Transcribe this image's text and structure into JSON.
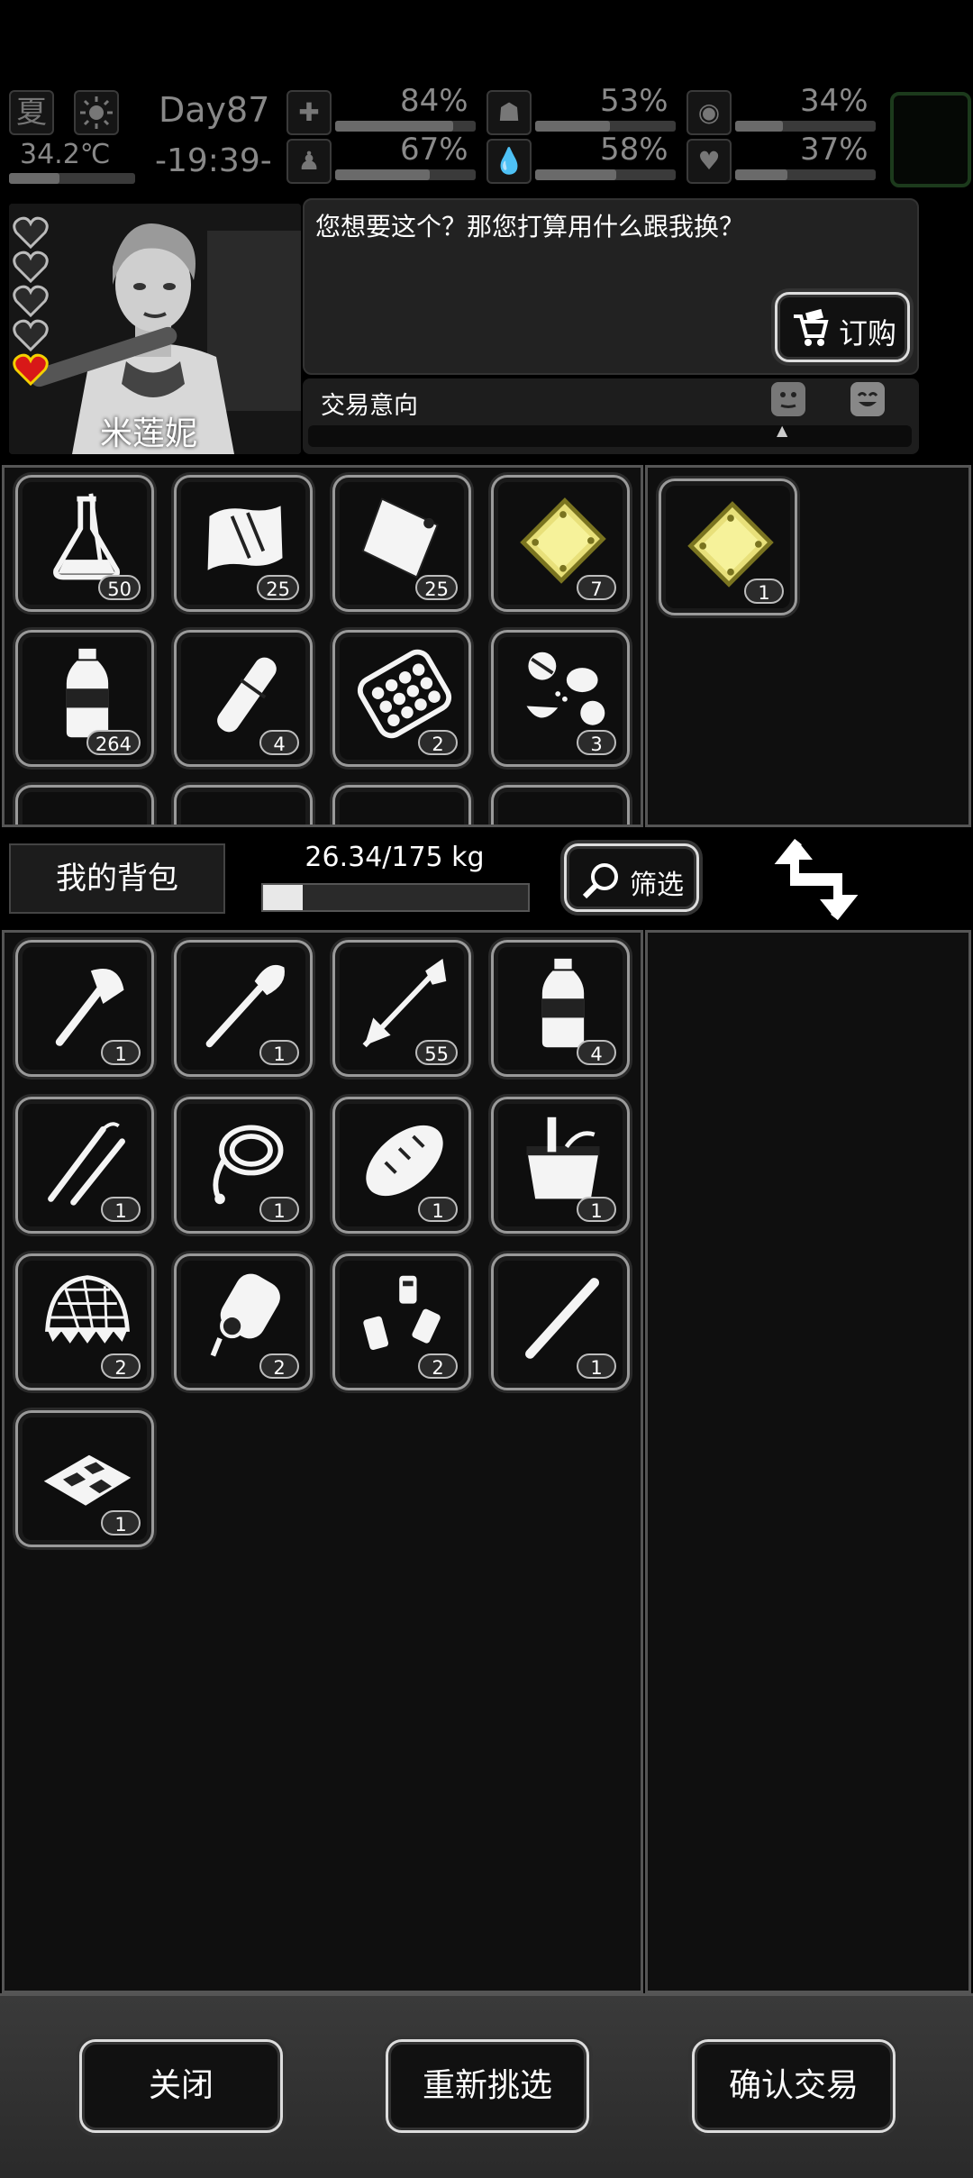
{
  "hud": {
    "season": "夏",
    "temperature": "34.2℃",
    "day": "Day87",
    "time": "-19:39-",
    "stats": [
      {
        "icon": "medkit-icon",
        "value": "84%",
        "level": 0.84
      },
      {
        "icon": "stomach-icon",
        "value": "53%",
        "level": 0.53
      },
      {
        "icon": "mental-icon",
        "value": "34%",
        "level": 0.34
      },
      {
        "icon": "stamina-icon",
        "value": "67%",
        "level": 0.67
      },
      {
        "icon": "water-drop-icon",
        "value": "58%",
        "level": 0.58
      },
      {
        "icon": "heart-icon",
        "value": "37%",
        "level": 0.37
      }
    ]
  },
  "npc": {
    "name": "米莲妮",
    "dialog": "您想要这个？那您打算用什么跟我换？",
    "order_label": "订购",
    "trade_intent_label": "交易意向",
    "hearts_total": 5,
    "hearts_filled": 1
  },
  "trader_items": [
    {
      "icon": "flask-icon",
      "count": "50"
    },
    {
      "icon": "cloth-icon",
      "count": "25"
    },
    {
      "icon": "bag-icon",
      "count": "25"
    },
    {
      "icon": "gold-plate-icon",
      "count": "7",
      "highlight": true
    },
    {
      "icon": "water-bottle-icon",
      "count": "264"
    },
    {
      "icon": "bandage-roll-icon",
      "count": "4"
    },
    {
      "icon": "pill-blister-icon",
      "count": "2"
    },
    {
      "icon": "pills-icon",
      "count": "3"
    }
  ],
  "selected_items": [
    {
      "icon": "gold-plate-icon",
      "count": "1",
      "highlight": true
    }
  ],
  "backpack": {
    "title": "我的背包",
    "weight_text": "26.34/175 kg",
    "weight_fraction": 0.15,
    "filter_label": "筛选"
  },
  "backpack_items": [
    {
      "icon": "axe-icon",
      "count": "1"
    },
    {
      "icon": "shovel-icon",
      "count": "1"
    },
    {
      "icon": "arrow-icon",
      "count": "55"
    },
    {
      "icon": "water-bottle-icon",
      "count": "4"
    },
    {
      "icon": "tweezers-icon",
      "count": "1"
    },
    {
      "icon": "rope-icon",
      "count": "1"
    },
    {
      "icon": "bread-icon",
      "count": "1"
    },
    {
      "icon": "bucket-icon",
      "count": "1"
    },
    {
      "icon": "net-icon",
      "count": "2"
    },
    {
      "icon": "glue-bottle-icon",
      "count": "2"
    },
    {
      "icon": "small-bottles-icon",
      "count": "2"
    },
    {
      "icon": "stick-icon",
      "count": "1"
    },
    {
      "icon": "tray-icon",
      "count": "1"
    }
  ],
  "footer": {
    "close_label": "关闭",
    "reselect_label": "重新挑选",
    "confirm_label": "确认交易"
  }
}
